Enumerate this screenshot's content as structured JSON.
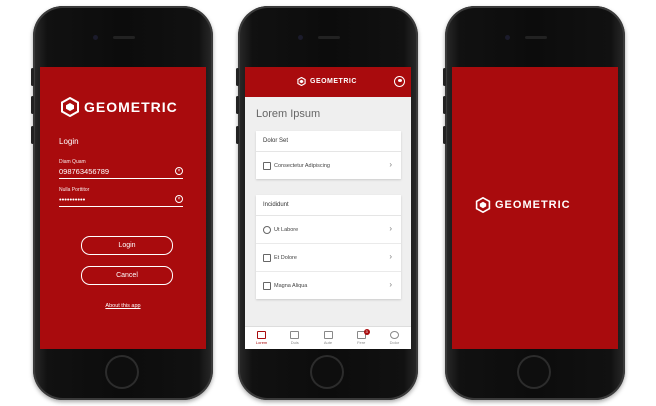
{
  "brand": {
    "name": "GEOMETRIC"
  },
  "login": {
    "title": "Login",
    "username_label": "Diam Quam",
    "username_value": "098763456789",
    "password_label": "Nulla Porttitor",
    "password_value": "••••••••••",
    "login_button": "Login",
    "cancel_button": "Cancel",
    "about_link": "About this app"
  },
  "home": {
    "page_title": "Lorem Ipsum",
    "card1": {
      "header": "Dolor Set",
      "items": [
        {
          "label": "Consectetur Adipiscing",
          "icon": "layers-icon"
        }
      ]
    },
    "card2": {
      "header": "Incididunt",
      "items": [
        {
          "label": "Ut Labore",
          "icon": "location-icon"
        },
        {
          "label": "Et Dolore",
          "icon": "id-card-icon"
        },
        {
          "label": "Magna Aliqua",
          "icon": "document-icon"
        }
      ]
    },
    "tabs": [
      {
        "label": "Lorem",
        "icon": "home-icon",
        "active": true
      },
      {
        "label": "Duis",
        "icon": "cube-icon"
      },
      {
        "label": "Aute",
        "icon": "monitor-icon"
      },
      {
        "label": "Fere",
        "icon": "gamepad-icon",
        "badge": "3"
      },
      {
        "label": "Dolor",
        "icon": "gear-icon"
      }
    ]
  },
  "colors": {
    "brand_red": "#a90b0d",
    "background": "#efefef"
  }
}
